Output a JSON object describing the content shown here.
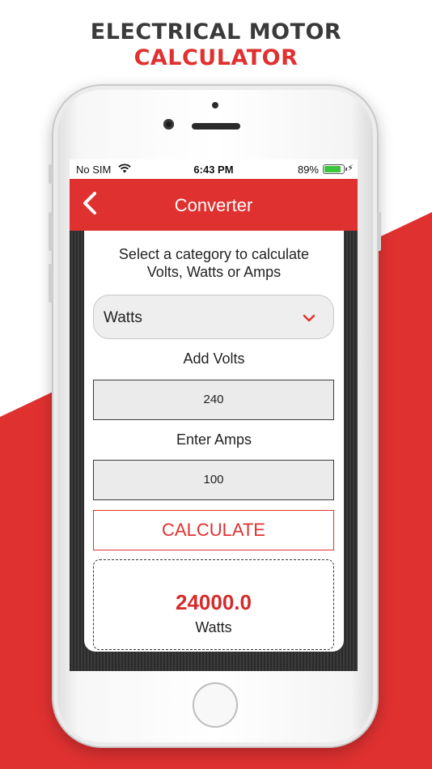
{
  "headline": {
    "line1": "ELECTRICAL MOTOR",
    "line2": "CALCULATOR"
  },
  "status_bar": {
    "carrier": "No SIM",
    "time": "6:43 PM",
    "battery": "89%",
    "battery_level": 0.89
  },
  "nav": {
    "title": "Converter"
  },
  "form": {
    "prompt_line1": "Select a category to calculate",
    "prompt_line2": "Volts, Watts or Amps",
    "category_selected": "Watts",
    "volts_label": "Add Volts",
    "volts_value": "240",
    "amps_label": "Enter Amps",
    "amps_value": "100",
    "calculate_label": "CALCULATE"
  },
  "result": {
    "value": "24000.0",
    "unit": "Watts"
  },
  "colors": {
    "accent": "#e03131",
    "battery_fill": "#3cc43c"
  },
  "icons": [
    "wifi-icon",
    "battery-icon",
    "charging-bolt-icon",
    "back-chevron-icon",
    "chevron-down-icon"
  ]
}
